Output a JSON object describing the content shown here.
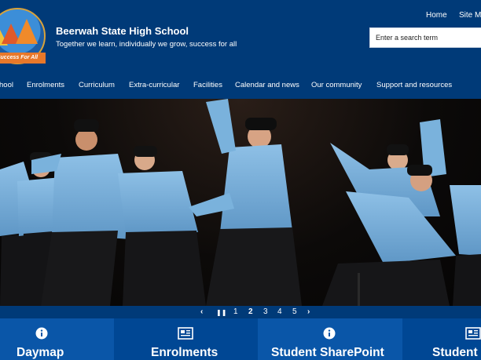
{
  "header": {
    "logo_text": "Success For All",
    "school_name": "Beerwah State High School",
    "tagline": "Together we learn, individually we grow, success for all"
  },
  "utility_nav": {
    "home": "Home",
    "site_map": "Site Ma"
  },
  "search": {
    "placeholder": "Enter a search term"
  },
  "nav": {
    "items": [
      "hool",
      "Enrolments",
      "Curriculum",
      "Extra-curricular",
      "Facilities",
      "Calendar and news",
      "Our community",
      "Support and resources"
    ]
  },
  "carousel": {
    "prev": "‹",
    "pause": "❚❚",
    "pages": [
      "1",
      "2",
      "3",
      "4",
      "5"
    ],
    "current": "2",
    "next": "›"
  },
  "tiles": [
    {
      "label": "Daymap",
      "icon": "info-icon",
      "color": "#0a56a8"
    },
    {
      "label": "Enrolments",
      "icon": "newspaper-icon",
      "color": "#004794"
    },
    {
      "label": "Student SharePoint",
      "icon": "info-icon",
      "color": "#0a56a8"
    },
    {
      "label": "Student",
      "icon": "newspaper-icon",
      "color": "#004794"
    }
  ],
  "colors": {
    "primary": "#003a78",
    "accent": "#e8782a",
    "hoodie": "#7ab2dc"
  }
}
